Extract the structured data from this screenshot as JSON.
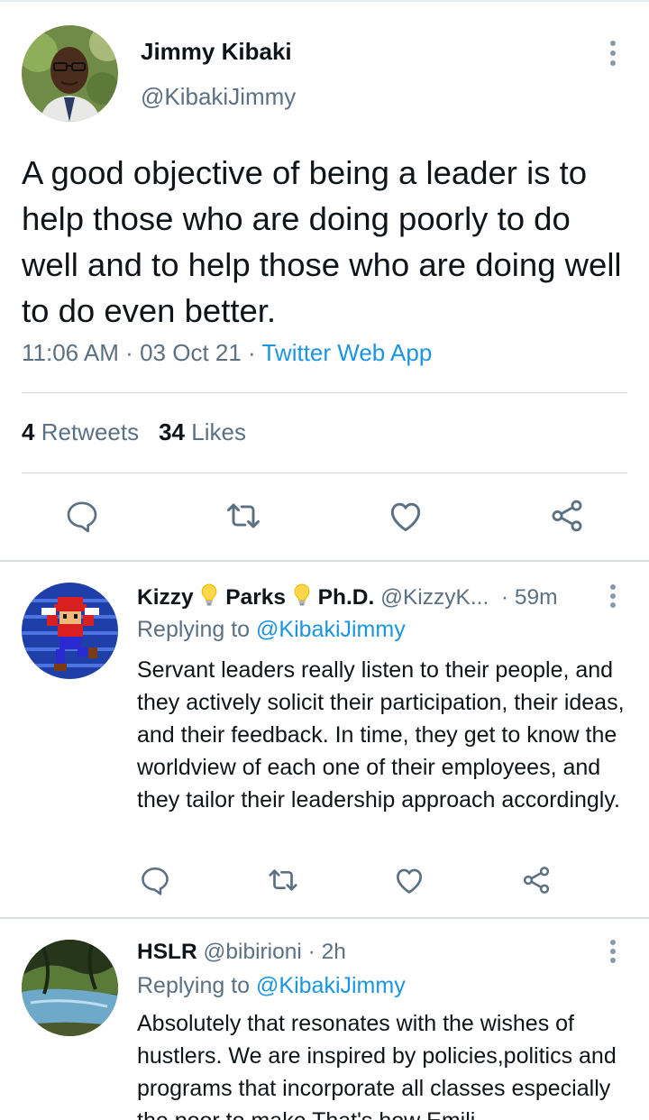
{
  "main_tweet": {
    "author_name": "Jimmy Kibaki",
    "author_handle": "@KibakiJimmy",
    "text": "A good objective of being a leader is to help those who are doing poorly to do well and to help those who are doing well to do even better.",
    "time": "11:06 AM",
    "date": "03 Oct 21",
    "dot": "·",
    "source": "Twitter Web App",
    "retweets_count": "4",
    "retweets_label": "Retweets",
    "likes_count": "34",
    "likes_label": "Likes"
  },
  "replies": [
    {
      "name_part1": "Kizzy",
      "name_part2": "Parks",
      "name_part3": "Ph.D.",
      "handle": "@KizzyK...",
      "time": "· 59m",
      "replying_prefix": "Replying to",
      "replying_to": "@KibakiJimmy",
      "text": "Servant leaders really listen to their people, and they actively solicit their participation, their ideas, and their feedback. In time, they get to know the worldview of each one of their employees, and they tailor their leadership approach accordingly."
    },
    {
      "name": "HSLR",
      "handle": "@bibirioni",
      "time": "· 2h",
      "replying_prefix": "Replying to",
      "replying_to": "@KibakiJimmy",
      "text": "Absolutely that resonates with the wishes of hustlers. We are inspired by policies,politics and programs that incorporate all classes especially the poor to make That's how Emili"
    }
  ],
  "icons": [
    "more-vert-icon",
    "reply-icon",
    "retweet-icon",
    "like-icon",
    "share-icon",
    "lightbulb-icon"
  ],
  "colors": {
    "accent": "#1b95e0",
    "secondary_text": "#5b7083",
    "primary_text": "#0f1419",
    "icon": "#5b7083"
  }
}
